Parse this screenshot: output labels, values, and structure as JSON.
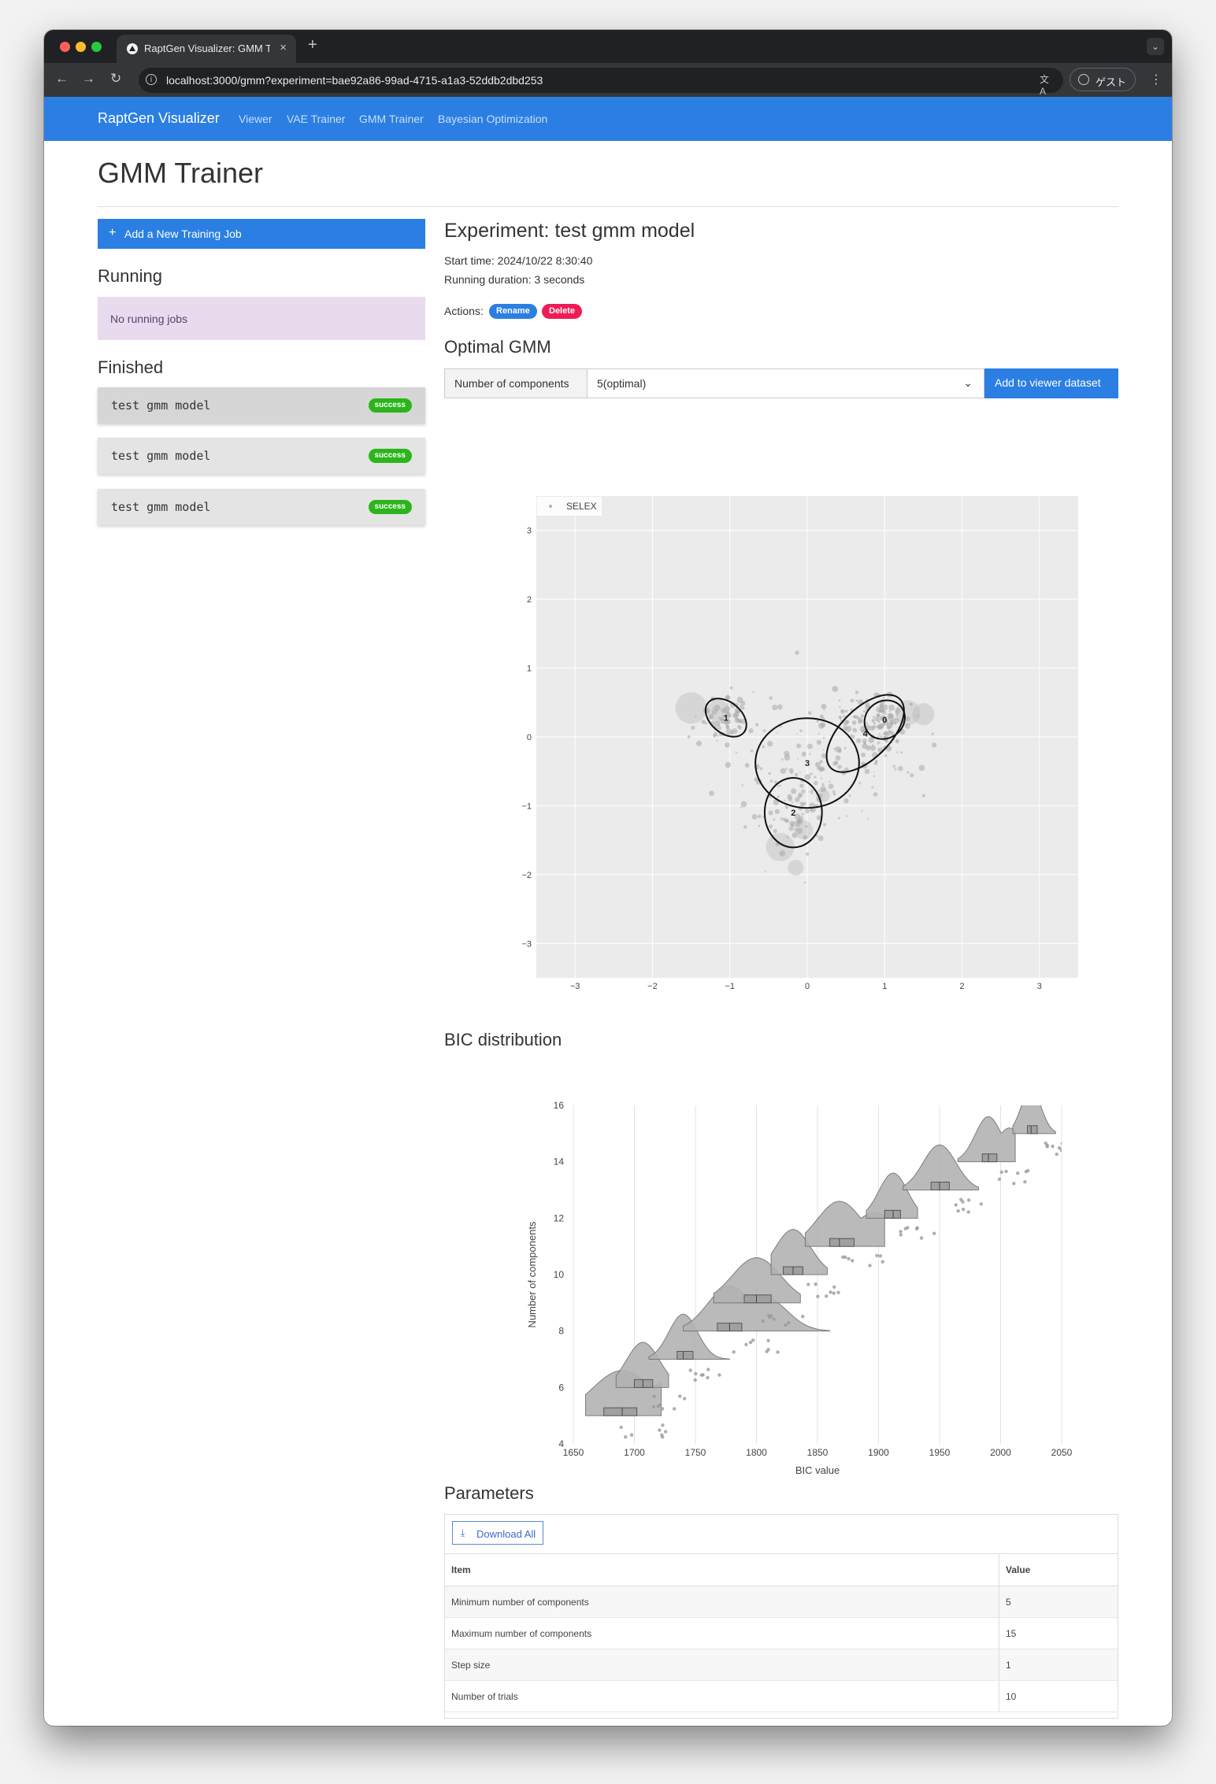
{
  "browser": {
    "tab_title": "RaptGen Visualizer: GMM Trainer",
    "tab_close": "×",
    "new_tab": "+",
    "url": "localhost:3000/gmm?experiment=bae92a86-99ad-4715-a1a3-52ddb2dbd253",
    "guest_label": "ゲスト"
  },
  "navbar": {
    "brand": "RaptGen Visualizer",
    "links": [
      "Viewer",
      "VAE Trainer",
      "GMM Trainer",
      "Bayesian Optimization"
    ]
  },
  "page": {
    "title": "GMM Trainer"
  },
  "sidebar": {
    "add_job_label": "Add a New Training Job",
    "running_heading": "Running",
    "no_running": "No running jobs",
    "finished_heading": "Finished",
    "jobs": [
      {
        "name": "test gmm model",
        "status": "success",
        "selected": true
      },
      {
        "name": "test gmm model",
        "status": "success",
        "selected": false
      },
      {
        "name": "test gmm model",
        "status": "success",
        "selected": false
      }
    ]
  },
  "experiment": {
    "title": "Experiment: test gmm model",
    "start_time": "Start time: 2024/10/22 8:30:40",
    "running_duration": "Running duration: 3 seconds",
    "actions_label": "Actions:",
    "rename_label": "Rename",
    "delete_label": "Delete"
  },
  "optimal_gmm": {
    "heading": "Optimal GMM",
    "select_prefix": "Number of components",
    "selected_value": "5(optimal)",
    "add_button": "Add to viewer dataset"
  },
  "bic": {
    "heading": "BIC distribution"
  },
  "parameters": {
    "heading": "Parameters",
    "download_label": "Download All",
    "header": {
      "item": "Item",
      "value": "Value"
    },
    "rows": [
      {
        "item": "Minimum number of components",
        "value": "5"
      },
      {
        "item": "Maximum number of components",
        "value": "15"
      },
      {
        "item": "Step size",
        "value": "1"
      },
      {
        "item": "Number of trials",
        "value": "10"
      }
    ]
  },
  "colors": {
    "primary": "#2b7fe3",
    "danger": "#ef1c54",
    "success": "#2bb51b",
    "running_bg": "#e9dbee"
  },
  "chart_data": [
    {
      "type": "scatter",
      "legend": [
        "SELEX"
      ],
      "legend_placement": "top-left",
      "xlim": [
        -3.5,
        3.5
      ],
      "ylim": [
        -3.5,
        3.5
      ],
      "x_ticks": [
        -3,
        -2,
        -1,
        0,
        1,
        2,
        3
      ],
      "y_ticks": [
        -3,
        -2,
        -1,
        0,
        1,
        2,
        3
      ],
      "grid": true,
      "gmm_components": [
        {
          "label": "0",
          "cx": 1.0,
          "cy": 0.25,
          "rx": 0.27,
          "ry": 0.24,
          "angle_deg": -35
        },
        {
          "label": "1",
          "cx": -1.05,
          "cy": 0.28,
          "rx": 0.3,
          "ry": 0.2,
          "angle_deg": 40
        },
        {
          "label": "2",
          "cx": -0.18,
          "cy": -1.1,
          "rx": 0.37,
          "ry": 0.45,
          "angle_deg": 0
        },
        {
          "label": "3",
          "cx": 0.0,
          "cy": -0.38,
          "rx": 0.67,
          "ry": 0.58,
          "angle_deg": 0
        },
        {
          "label": "4",
          "cx": 0.75,
          "cy": 0.05,
          "rx": 0.63,
          "ry": 0.32,
          "angle_deg": -45
        }
      ]
    },
    {
      "type": "violin",
      "xlabel": "BIC value",
      "ylabel": "Number of components",
      "xlim": [
        1650,
        2050
      ],
      "ylim": [
        4,
        16
      ],
      "x_ticks": [
        1650,
        1700,
        1750,
        1800,
        1850,
        1900,
        1950,
        2000,
        2050
      ],
      "y_ticks": [
        4,
        6,
        8,
        10,
        12,
        14,
        16
      ],
      "categories": [
        5,
        6,
        7,
        8,
        9,
        10,
        11,
        12,
        13,
        14,
        15
      ],
      "medians": [
        1690,
        1707,
        1740,
        1778,
        1800,
        1830,
        1868,
        1912,
        1950,
        1990,
        2025
      ],
      "q1": [
        1675,
        1700,
        1735,
        1768,
        1790,
        1822,
        1860,
        1905,
        1943,
        1985,
        2022
      ],
      "q3": [
        1702,
        1715,
        1748,
        1788,
        1812,
        1838,
        1880,
        1918,
        1958,
        1997,
        2030
      ],
      "min": [
        1660,
        1685,
        1712,
        1740,
        1765,
        1812,
        1840,
        1890,
        1920,
        1965,
        2010
      ],
      "max": [
        1722,
        1728,
        1778,
        1860,
        1836,
        1858,
        1905,
        1932,
        1982,
        2012,
        2045
      ]
    }
  ]
}
